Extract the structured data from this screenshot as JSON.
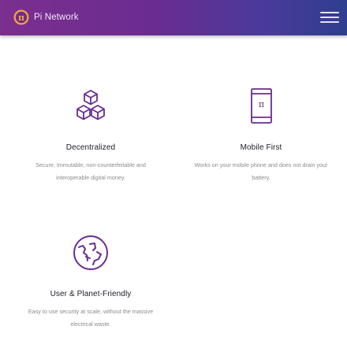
{
  "navbar": {
    "brand_name": "Pi Network",
    "logo_glyph": "π",
    "menu_icon": "hamburger-menu-icon"
  },
  "colors": {
    "navbar_gradient_start": "#7b2f8f",
    "navbar_gradient_end": "#2f3e8f",
    "icon_purple": "#6a2c91",
    "title_text": "#1d1d24",
    "description_text": "#8c8c92"
  },
  "features": [
    {
      "icon": "cubes-icon",
      "title": "Decentralized",
      "description": "Secure, Immutable, non-counterfeitable and interoperable digital money."
    },
    {
      "icon": "mobile-phone-icon",
      "title": "Mobile First",
      "description": "Works on your mobile phone and does not drain your battery."
    },
    {
      "icon": "planet-icon",
      "title": "User & Planet-Friendly",
      "description": "Easy to use security at scale, without the massive electrical waste."
    }
  ]
}
